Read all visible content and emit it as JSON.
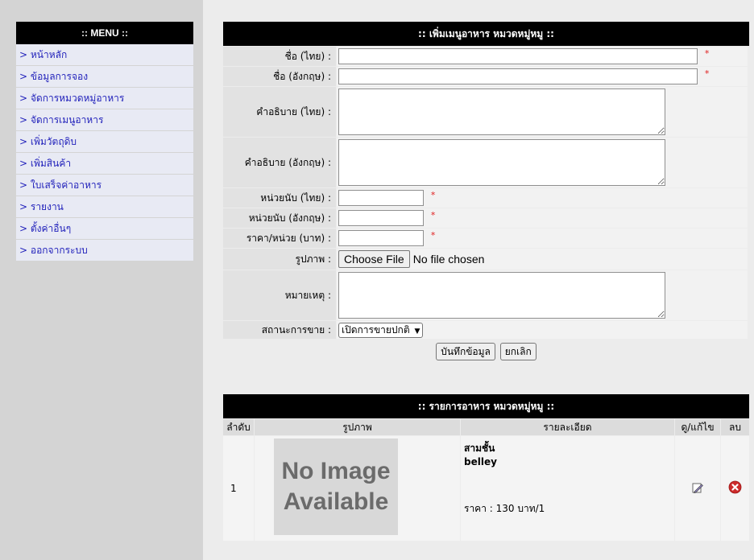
{
  "menu": {
    "title": ":: MENU ::",
    "items": [
      "> หน้าหลัก",
      "> ข้อมูลการจอง",
      "> จัดการหมวดหมู่อาหาร",
      "> จัดการเมนูอาหาร",
      "> เพิ่มวัตถุดิบ",
      "> เพิ่มสินค้า",
      "> ใบเสร็จค่าอาหาร",
      "> รายงาน",
      "> ตั้งค่าอื่นๆ",
      "> ออกจากระบบ"
    ]
  },
  "form": {
    "title": ":: เพิ่มเมนูอาหาร หมวดหมู่หมู ::",
    "labels": {
      "name_th": "ชื่อ (ไทย) :",
      "name_en": "ชื่อ (อังกฤษ) :",
      "desc_th": "คำอธิบาย (ไทย) :",
      "desc_en": "คำอธิบาย (อังกฤษ) :",
      "unit_th": "หน่วยนับ (ไทย) :",
      "unit_en": "หน่วยนับ (อังกฤษ) :",
      "price": "ราคา/หน่วย (บาท) :",
      "image": "รูปภาพ :",
      "note": "หมายเหตุ :",
      "status": "สถานะการขาย :"
    },
    "required_mark": "*",
    "file_button": "Choose File",
    "file_status": "No file chosen",
    "status_selected": "เปิดการขายปกติ",
    "save_button": "บันทึกข้อมูล",
    "cancel_button": "ยกเลิก"
  },
  "list": {
    "title": ":: รายการอาหาร หมวดหมู่หมู ::",
    "columns": [
      "ลำดับ",
      "รูปภาพ",
      "รายละเอียด",
      "ดู/แก้ไข",
      "ลบ"
    ],
    "rows": [
      {
        "no": "1",
        "image_line1": "No Image",
        "image_line2": "Available",
        "name_th": "สามชั้น",
        "name_en": "belley",
        "price": "ราคา : 130 บาท/1"
      }
    ]
  }
}
